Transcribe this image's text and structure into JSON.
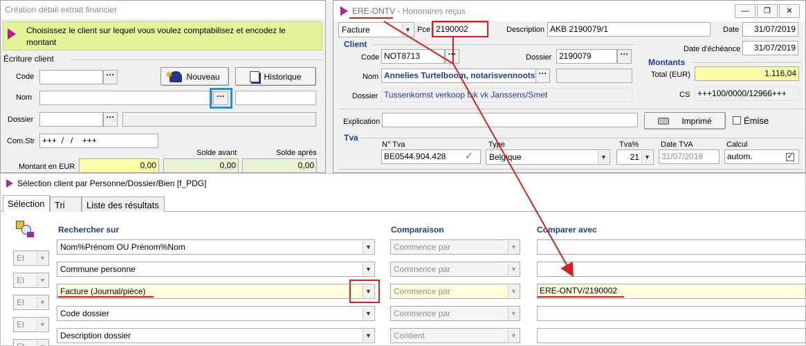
{
  "left_window": {
    "title": "Création détail extrait financier",
    "banner": "Choisissez le client sur lequel vous voulez comptabilisez et encodez le montant",
    "group_title": "Écriture client",
    "code_label": "Code",
    "nom_label": "Nom",
    "dossier_label": "Dossier",
    "comstr_label": "Com.Str",
    "comstr_value": "+++  /   /    +++",
    "solde_avant_label": "Solde avant",
    "solde_apres_label": "Solde après",
    "montant_label": "Montant en EUR",
    "montant_value": "0,00",
    "solde_avant_value": "0,00",
    "solde_apres_value": "0,00",
    "nouveau_label": "Nouveau",
    "historique_label": "Historique",
    "dots": "···"
  },
  "right_window": {
    "title_prefix": "ERE-ONTV",
    "title_suffix": " - Honoraires reçus",
    "doc_type": "Facture",
    "pce_label": "Pce",
    "pce_value": "2190002",
    "description_label": "Description",
    "description_value": "AKB 2190079/1",
    "date_label": "Date",
    "date_value": "31/07/2019",
    "echeance_label": "Date d'échéance",
    "echeance_value": "31/07/2019",
    "client_group": "Client",
    "code_label": "Code",
    "code_value": "NOT8713",
    "dossier_label": "Dossier",
    "dossier_value": "2190079",
    "nom_label": "Nom",
    "nom_value": "Annelies Turtelboom, notarisvennootsc",
    "dossier_desc_label": "Dossier",
    "dossier_desc_value": "Tussenkomst verkoop tsk vk Janssens/Smet",
    "montants_group": "Montants",
    "total_label": "Total (EUR)",
    "total_value": "1.116,04",
    "cs_label": "CS",
    "cs_value": "+++100/0000/12966+++",
    "explication_label": "Explication",
    "imprime_label": "Imprimé",
    "emise_label": "Émise",
    "tva_group": "Tva",
    "ntva_label": "N° Tva",
    "ntva_value": "BE0544.904.428",
    "type_label": "Type",
    "type_value": "Belgique",
    "tvapct_label": "Tva%",
    "tvapct_value": "21",
    "datetva_label": "Date TVA",
    "datetva_value": "31/07/2019",
    "calcul_label": "Calcul",
    "calcul_value": "autom.",
    "dots": "···"
  },
  "selection_window": {
    "title": "Sélection client par Personne/Dossier/Bien [f_PDG]",
    "tabs": [
      "Sélection",
      "Tri",
      "Liste des résultats"
    ],
    "col_rechercher": "Rechercher sur",
    "col_comparaison": "Comparaison",
    "col_comparer": "Comparer avec",
    "rows": [
      {
        "connector": "",
        "field": "Nom%Prénom OU Prénom%Nom",
        "comparison": "Commence par",
        "value": ""
      },
      {
        "connector": "Et",
        "field": "Commune personne",
        "comparison": "Commence par",
        "value": ""
      },
      {
        "connector": "Et",
        "field": "Facture (Journal/pièce)",
        "comparison": "Commence par",
        "value": "ERE-ONTV/2190002"
      },
      {
        "connector": "Et",
        "field": "Code dossier",
        "comparison": "Commence par",
        "value": ""
      },
      {
        "connector": "Et",
        "field": "Description dossier",
        "comparison": "Contient",
        "value": ""
      }
    ],
    "connector_first": "Et"
  },
  "colors": {
    "accent_blue": "#1c3f8f",
    "highlight_yellow": "#ffffa8",
    "annotation_red": "#d42020",
    "focus_blue": "#1e90e0"
  }
}
